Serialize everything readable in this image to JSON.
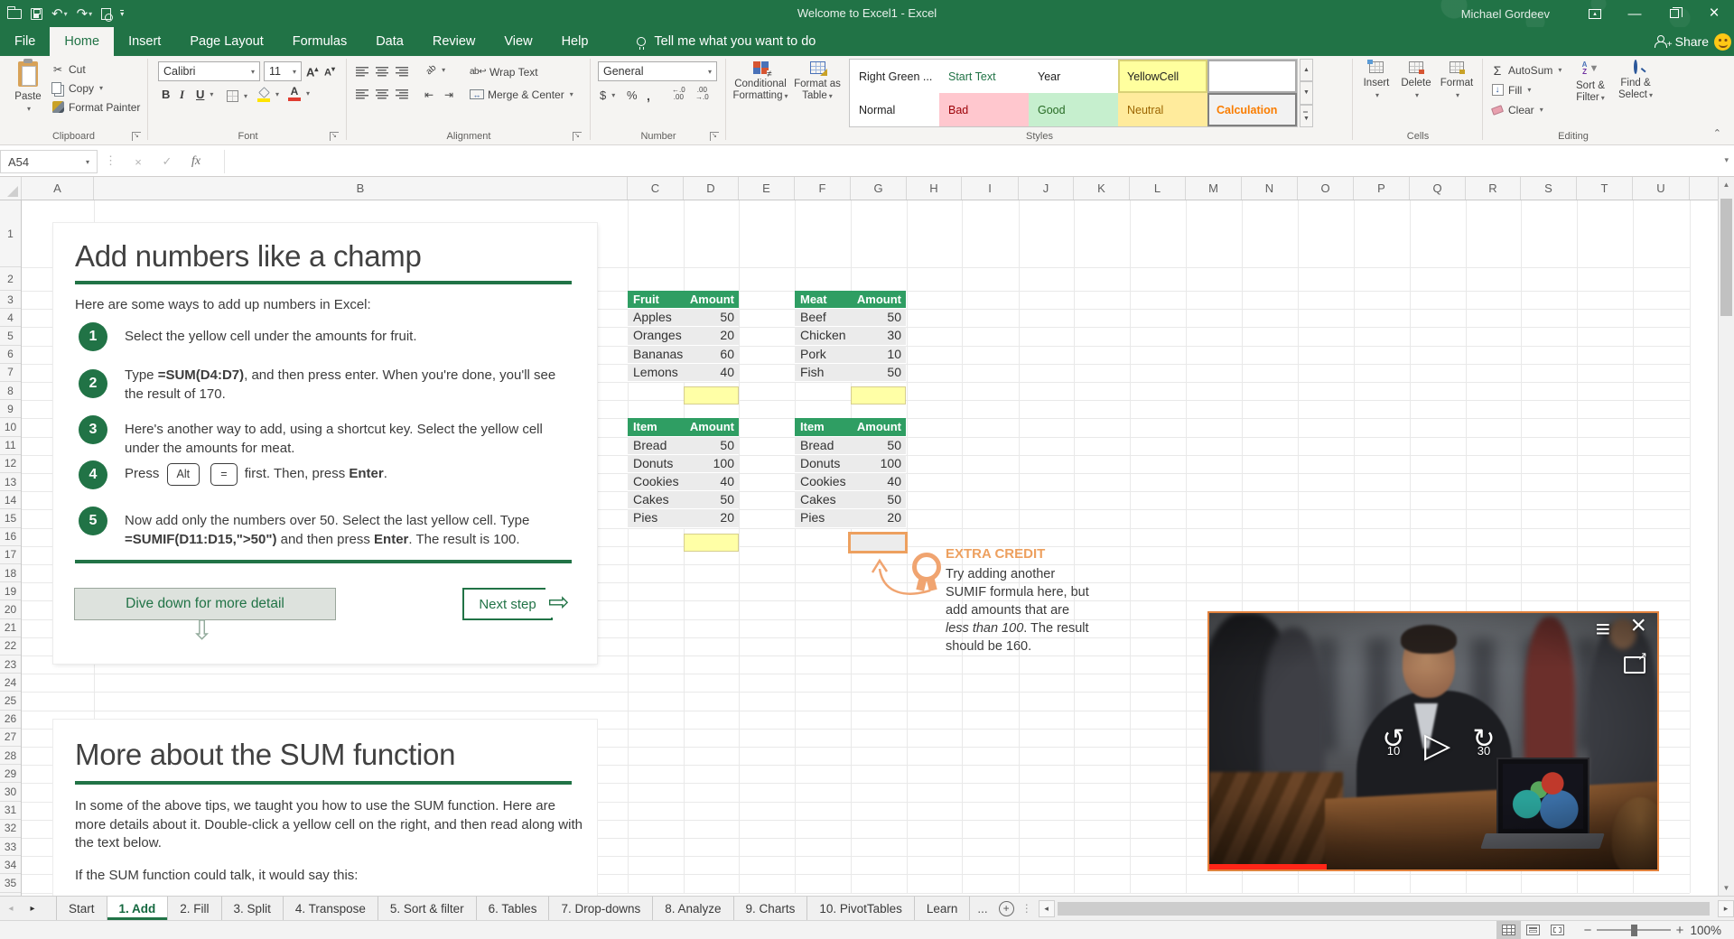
{
  "titlebar": {
    "title": "Welcome to Excel1  -  Excel",
    "user": "Michael Gordeev",
    "qat_icons": [
      "open-file",
      "save",
      "undo",
      "redo",
      "print-preview",
      "customize-quick-access-toolbar"
    ],
    "window_icons": [
      "ribbon-display-options",
      "minimize",
      "restore",
      "close"
    ]
  },
  "ribbon": {
    "tabs": [
      {
        "label": "File",
        "active": false
      },
      {
        "label": "Home",
        "active": true
      },
      {
        "label": "Insert",
        "active": false
      },
      {
        "label": "Page Layout",
        "active": false
      },
      {
        "label": "Formulas",
        "active": false
      },
      {
        "label": "Data",
        "active": false
      },
      {
        "label": "Review",
        "active": false
      },
      {
        "label": "View",
        "active": false
      },
      {
        "label": "Help",
        "active": false
      }
    ],
    "tell_me": "Tell me what you want to do",
    "share_label": "Share",
    "groups": {
      "clipboard": {
        "label": "Clipboard",
        "paste": "Paste",
        "cut": "Cut",
        "copy": "Copy",
        "format_painter": "Format Painter"
      },
      "font": {
        "label": "Font",
        "family": "Calibri",
        "size": "11"
      },
      "alignment": {
        "label": "Alignment",
        "wrap_text": "Wrap Text",
        "merge_center": "Merge & Center"
      },
      "number": {
        "label": "Number",
        "format": "General"
      },
      "styles": {
        "label": "Styles",
        "conditional_formatting_1": "Conditional",
        "conditional_formatting_2": "Formatting",
        "format_as_table_1": "Format as",
        "format_as_table_2": "Table",
        "gallery": [
          {
            "label": "Right Green ...",
            "fg": "#1f1f1f",
            "bg": "#ffffff"
          },
          {
            "label": "Start Text",
            "fg": "#217346",
            "bg": "#ffffff"
          },
          {
            "label": "Year",
            "fg": "#1f1f1f",
            "bg": "#ffffff"
          },
          {
            "label": "YellowCell",
            "fg": "#1f1f1f",
            "bg": "#ffff9e",
            "border": "#d9d177"
          },
          {
            "label": "",
            "fg": "#1f1f1f",
            "bg": "#ffffff",
            "border": "#ababab"
          },
          {
            "label": "Normal",
            "fg": "#1f1f1f",
            "bg": "#ffffff"
          },
          {
            "label": "Bad",
            "fg": "#9c0006",
            "bg": "#ffc7ce"
          },
          {
            "label": "Good",
            "fg": "#276b24",
            "bg": "#c6efce"
          },
          {
            "label": "Neutral",
            "fg": "#9c6500",
            "bg": "#ffeb9c"
          },
          {
            "label": "Calculation",
            "fg": "#fa7d00",
            "bg": "#f2f2f2",
            "border": "#7f7f7f",
            "bold": true
          }
        ]
      },
      "cells": {
        "label": "Cells",
        "insert": "Insert",
        "delete": "Delete",
        "format": "Format"
      },
      "editing": {
        "label": "Editing",
        "autosum": "AutoSum",
        "fill": "Fill",
        "clear": "Clear",
        "sort_filter_1": "Sort &",
        "sort_filter_2": "Filter",
        "find_select_1": "Find &",
        "find_select_2": "Select"
      }
    }
  },
  "formula_bar": {
    "name_box": "A54",
    "buttons": [
      "cancel",
      "enter",
      "insert-function"
    ],
    "value": ""
  },
  "grid": {
    "columns": [
      "A",
      "B",
      "C",
      "D",
      "E",
      "F",
      "G",
      "H",
      "I",
      "J",
      "K",
      "L",
      "M",
      "N",
      "O",
      "P",
      "Q",
      "R",
      "S",
      "T",
      "U"
    ],
    "rows": [
      1,
      2,
      3,
      4,
      5,
      6,
      7,
      8,
      9,
      10,
      11,
      12,
      13,
      14,
      15,
      16,
      17,
      18,
      19,
      20,
      21,
      22,
      23,
      24,
      25,
      26,
      27,
      28,
      29,
      30,
      31,
      32,
      33,
      34,
      35
    ]
  },
  "card1": {
    "title": "Add numbers like a champ",
    "intro": "Here are some ways to add up numbers in Excel:",
    "steps": [
      {
        "num": "1",
        "segments": [
          {
            "t": "Select the yellow cell under the amounts for fruit."
          }
        ]
      },
      {
        "num": "2",
        "segments": [
          {
            "t": "Type "
          },
          {
            "t": "=SUM(D4:D7)",
            "b": true
          },
          {
            "t": ", and then press enter. When you're done, you'll see the result of 170."
          }
        ]
      },
      {
        "num": "3",
        "segments": [
          {
            "t": "Here's another way to add, using a shortcut key. Select the yellow cell under the amounts for meat."
          }
        ]
      },
      {
        "num": "4",
        "segments": [
          {
            "t": "Press "
          },
          {
            "t": "Alt",
            "kbd": true
          },
          {
            "t": " "
          },
          {
            "t": "=",
            "kbd": true
          },
          {
            "t": " first. Then, press "
          },
          {
            "t": "Enter",
            "b": true
          },
          {
            "t": "."
          }
        ]
      },
      {
        "num": "5",
        "segments": [
          {
            "t": "Now add only the numbers over 50. Select the last yellow cell. Type "
          },
          {
            "t": "=SUMIF(D11:D15,\">50\")",
            "b": true
          },
          {
            "t": " and then press "
          },
          {
            "t": "Enter",
            "b": true
          },
          {
            "t": ". The result is 100."
          }
        ]
      }
    ],
    "dive_button": "Dive down for more detail",
    "next_button": "Next step"
  },
  "tables": {
    "fruit": {
      "headers": [
        "Fruit",
        "Amount"
      ],
      "rows": [
        [
          "Apples",
          "50"
        ],
        [
          "Oranges",
          "20"
        ],
        [
          "Bananas",
          "60"
        ],
        [
          "Lemons",
          "40"
        ]
      ],
      "empty_cell": "yellow"
    },
    "meat": {
      "headers": [
        "Meat",
        "Amount"
      ],
      "rows": [
        [
          "Beef",
          "50"
        ],
        [
          "Chicken",
          "30"
        ],
        [
          "Pork",
          "10"
        ],
        [
          "Fish",
          "50"
        ]
      ],
      "empty_cell": "yellow"
    },
    "items_left": {
      "headers": [
        "Item",
        "Amount"
      ],
      "rows": [
        [
          "Bread",
          "50"
        ],
        [
          "Donuts",
          "100"
        ],
        [
          "Cookies",
          "40"
        ],
        [
          "Cakes",
          "50"
        ],
        [
          "Pies",
          "20"
        ]
      ],
      "empty_cell": "yellow"
    },
    "items_right": {
      "headers": [
        "Item",
        "Amount"
      ],
      "rows": [
        [
          "Bread",
          "50"
        ],
        [
          "Donuts",
          "100"
        ],
        [
          "Cookies",
          "40"
        ],
        [
          "Cakes",
          "50"
        ],
        [
          "Pies",
          "20"
        ]
      ],
      "empty_cell": "orange-selected"
    }
  },
  "extra_credit": {
    "title": "EXTRA CREDIT",
    "segments": [
      {
        "t": "Try adding another SUMIF formula here, but add amounts that are "
      },
      {
        "t": "less than 100",
        "i": true
      },
      {
        "t": ". The result should be 160."
      }
    ]
  },
  "card2": {
    "title": "More about the SUM function",
    "p1": "In some of the above tips, we taught you how to use the SUM function. Here are more details about it. Double-click a yellow cell on the right, and then read along with the text below.",
    "p2": "If the SUM function could talk, it would say this:"
  },
  "sheet_tabs": {
    "items": [
      {
        "label": "Start",
        "active": false
      },
      {
        "label": "1. Add",
        "active": true
      },
      {
        "label": "2. Fill",
        "active": false
      },
      {
        "label": "3. Split",
        "active": false
      },
      {
        "label": "4. Transpose",
        "active": false
      },
      {
        "label": "5. Sort & filter",
        "active": false
      },
      {
        "label": "6. Tables",
        "active": false
      },
      {
        "label": "7. Drop-downs",
        "active": false
      },
      {
        "label": "8. Analyze",
        "active": false
      },
      {
        "label": "9. Charts",
        "active": false
      },
      {
        "label": "10. PivotTables",
        "active": false
      },
      {
        "label": "Learn",
        "active": false
      }
    ],
    "overflow": "..."
  },
  "status_bar": {
    "zoom": "100%",
    "views": [
      "normal",
      "page-layout",
      "page-break-preview"
    ]
  },
  "video": {
    "skip_back_label": "10",
    "skip_forward_label": "30",
    "icons": [
      "menu",
      "close",
      "pop-out",
      "skip-back",
      "play",
      "skip-forward"
    ]
  },
  "colors": {
    "excel_green": "#217346",
    "table_header_green": "#2f9e63",
    "yellow_cell": "#ffffa6",
    "yellow_cell_border": "#d6ce8e",
    "orange_accent": "#eda05f",
    "video_border": "#e2823d",
    "progress_red": "#ff2517"
  }
}
